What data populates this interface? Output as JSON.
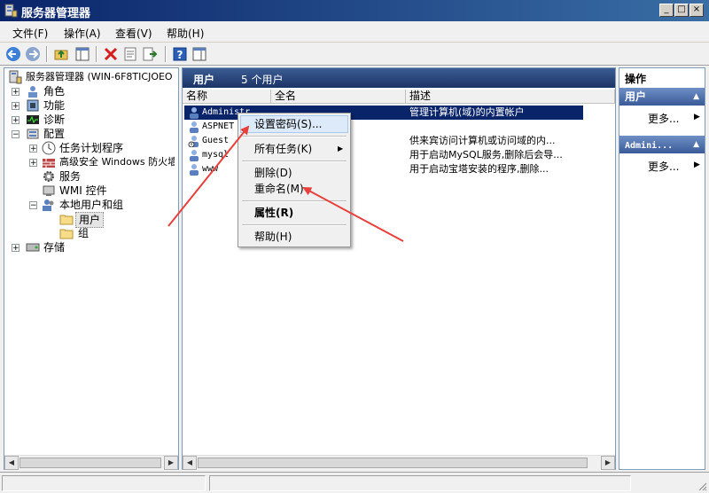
{
  "window": {
    "title": "服务器管理器",
    "buttons": {
      "minimize": "_",
      "maximize": "□",
      "close": "×"
    }
  },
  "menu": [
    "文件(F)",
    "操作(A)",
    "查看(V)",
    "帮助(H)"
  ],
  "tree": {
    "root": "服务器管理器 (WIN-6F8TICJOEO",
    "items": [
      {
        "label": "角色",
        "expander": "+"
      },
      {
        "label": "功能",
        "expander": "+"
      },
      {
        "label": "诊断",
        "expander": "+"
      },
      {
        "label": "配置",
        "expander": "−"
      },
      {
        "label": "任务计划程序",
        "expander": "+"
      },
      {
        "label": "高级安全 Windows 防火墙",
        "expander": "+"
      },
      {
        "label": "服务",
        "expander": ""
      },
      {
        "label": "WMI 控件",
        "expander": ""
      },
      {
        "label": "本地用户和组",
        "expander": "−"
      },
      {
        "label": "用户",
        "expander": ""
      },
      {
        "label": "组",
        "expander": ""
      },
      {
        "label": "存储",
        "expander": "+"
      }
    ]
  },
  "list": {
    "header_title": "用户",
    "header_count": "5 个用户",
    "columns": [
      "名称",
      "全名",
      "描述"
    ],
    "rows": [
      {
        "name": "Administr",
        "desc": "管理计算机(域)的内置帐户"
      },
      {
        "name": "ASPNET",
        "desc": ""
      },
      {
        "name": "Guest",
        "desc": "供来宾访问计算机或访问域的内..."
      },
      {
        "name": "mysql",
        "desc": "用于启动MySQL服务,删除后会导..."
      },
      {
        "name": "www",
        "desc": "用于启动宝塔安装的程序,删除..."
      }
    ]
  },
  "context_menu": {
    "items": [
      "设置密码(S)...",
      "所有任务(K)",
      "删除(D)",
      "重命名(M)",
      "属性(R)",
      "帮助(H)"
    ],
    "submenu_arrow": "▶"
  },
  "actions": {
    "title": "操作",
    "section1": "用户",
    "section1_more": "更多...",
    "section2": "Admini...",
    "section2_more": "更多...",
    "more_arrow": "▶",
    "collapse_arrow": "▲"
  },
  "colors": {
    "titlebar": "#0a246a",
    "selection": "#0a246a",
    "annotation_arrow": "#e8413c"
  }
}
